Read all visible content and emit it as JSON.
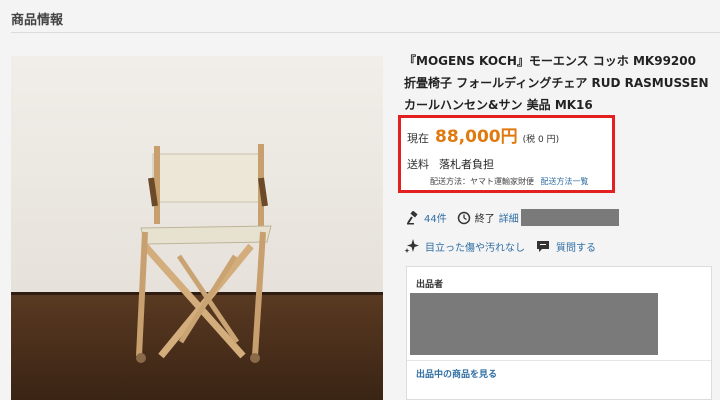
{
  "section": {
    "title": "商品情報"
  },
  "product": {
    "title": "『MOGENS KOCH』モーエンス コッホ MK99200 折畳椅子 フォールディングチェア RUD RASMUSSEN カールハンセン&サン 美品 MK16",
    "image_alt": "folding-chair-photo"
  },
  "price": {
    "label": "現在",
    "value": "88,000円",
    "tax": "(税 0 円)",
    "highlight_color": "#e41f1f",
    "value_color": "#e07a10"
  },
  "shipping": {
    "label": "送料",
    "value": "落札者負担",
    "method_text": "配送方法：ヤマト運輸家財便",
    "method_link": "配送方法一覧"
  },
  "meta": {
    "bids": "44件",
    "end_label": "終了",
    "detail_link": "詳細"
  },
  "condition": {
    "text": "目立った傷や汚れなし",
    "question_link": "質問する"
  },
  "seller": {
    "label": "出品者",
    "items_link": "出品中の商品を見る"
  },
  "icons": {
    "bid": "gavel-icon",
    "clock": "clock-icon",
    "sparkle": "sparkle-icon",
    "question": "chat-bubble-icon"
  }
}
